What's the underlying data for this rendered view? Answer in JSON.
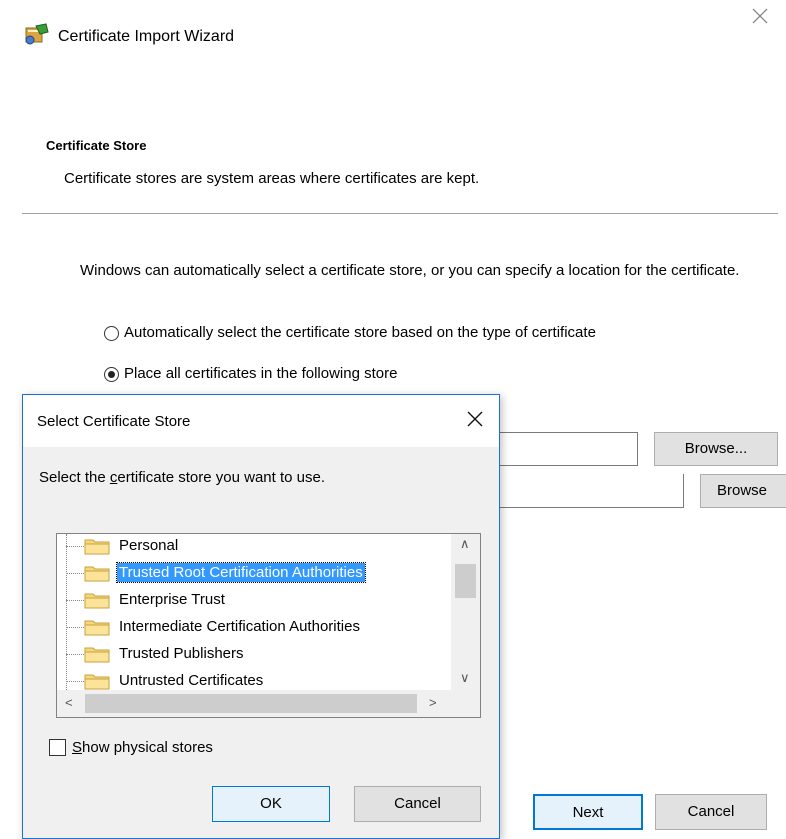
{
  "wizard": {
    "title": "Certificate Import Wizard",
    "section_heading": "Certificate Store",
    "section_description": "Certificate stores are system areas where certificates are kept.",
    "intro": "Windows can automatically select a certificate store, or you can specify a location for the certificate.",
    "radio_auto_label": "Automatically select the certificate store based on the type of certificate",
    "radio_place_label": "Place all certificates in the following store",
    "selected_option": "place",
    "browse_label": "Browse...",
    "browse2_label": "Browse",
    "next_label": "Next",
    "cancel_label": "Cancel"
  },
  "dialog": {
    "title": "Select Certificate Store",
    "prompt_before": "Select the ",
    "prompt_underline": "c",
    "prompt_after": "ertificate store you want to use.",
    "stores": [
      {
        "label": "Personal",
        "selected": false
      },
      {
        "label": "Trusted Root Certification Authorities",
        "selected": true
      },
      {
        "label": "Enterprise Trust",
        "selected": false
      },
      {
        "label": "Intermediate Certification Authorities",
        "selected": false
      },
      {
        "label": "Trusted Publishers",
        "selected": false
      },
      {
        "label": "Untrusted Certificates",
        "selected": false
      }
    ],
    "show_physical_underline": "S",
    "show_physical_rest": "how physical stores",
    "show_physical_checked": false,
    "ok_label": "OK",
    "cancel_label": "Cancel"
  },
  "colors": {
    "selection": "#3399ff",
    "accent_border": "#0078d7",
    "dialog_border": "#1a73d2"
  }
}
